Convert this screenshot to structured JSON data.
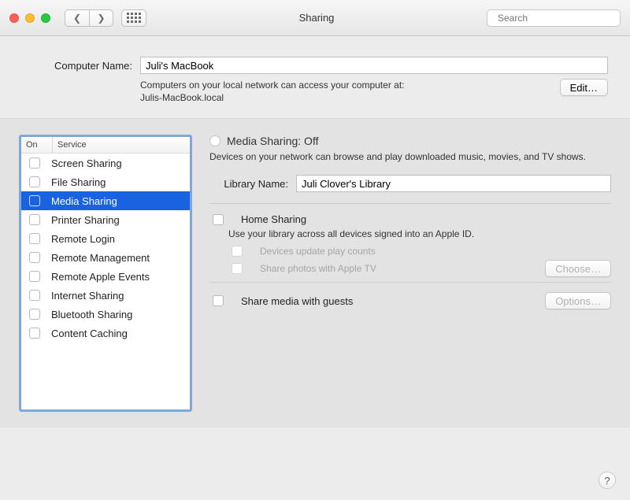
{
  "window": {
    "title": "Sharing"
  },
  "toolbar": {
    "search_placeholder": "Search"
  },
  "computer": {
    "label": "Computer Name:",
    "value": "Juli's MacBook",
    "hint_line1": "Computers on your local network can access your computer at:",
    "hint_line2": "Julis-MacBook.local",
    "edit_label": "Edit…"
  },
  "services": {
    "header_on": "On",
    "header_service": "Service",
    "items": [
      {
        "name": "Screen Sharing",
        "on": false,
        "selected": false
      },
      {
        "name": "File Sharing",
        "on": false,
        "selected": false
      },
      {
        "name": "Media Sharing",
        "on": false,
        "selected": true
      },
      {
        "name": "Printer Sharing",
        "on": false,
        "selected": false
      },
      {
        "name": "Remote Login",
        "on": false,
        "selected": false
      },
      {
        "name": "Remote Management",
        "on": false,
        "selected": false
      },
      {
        "name": "Remote Apple Events",
        "on": false,
        "selected": false
      },
      {
        "name": "Internet Sharing",
        "on": false,
        "selected": false
      },
      {
        "name": "Bluetooth Sharing",
        "on": false,
        "selected": false
      },
      {
        "name": "Content Caching",
        "on": false,
        "selected": false
      }
    ]
  },
  "detail": {
    "title": "Media Sharing: Off",
    "desc": "Devices on your network can browse and play downloaded music, movies, and TV shows.",
    "library_label": "Library Name:",
    "library_value": "Juli Clover's Library",
    "home_sharing_label": "Home Sharing",
    "home_sharing_desc": "Use your library across all devices signed into an Apple ID.",
    "devices_update_label": "Devices update play counts",
    "share_photos_label": "Share photos with Apple TV",
    "choose_label": "Choose…",
    "share_guests_label": "Share media with guests",
    "options_label": "Options…"
  }
}
